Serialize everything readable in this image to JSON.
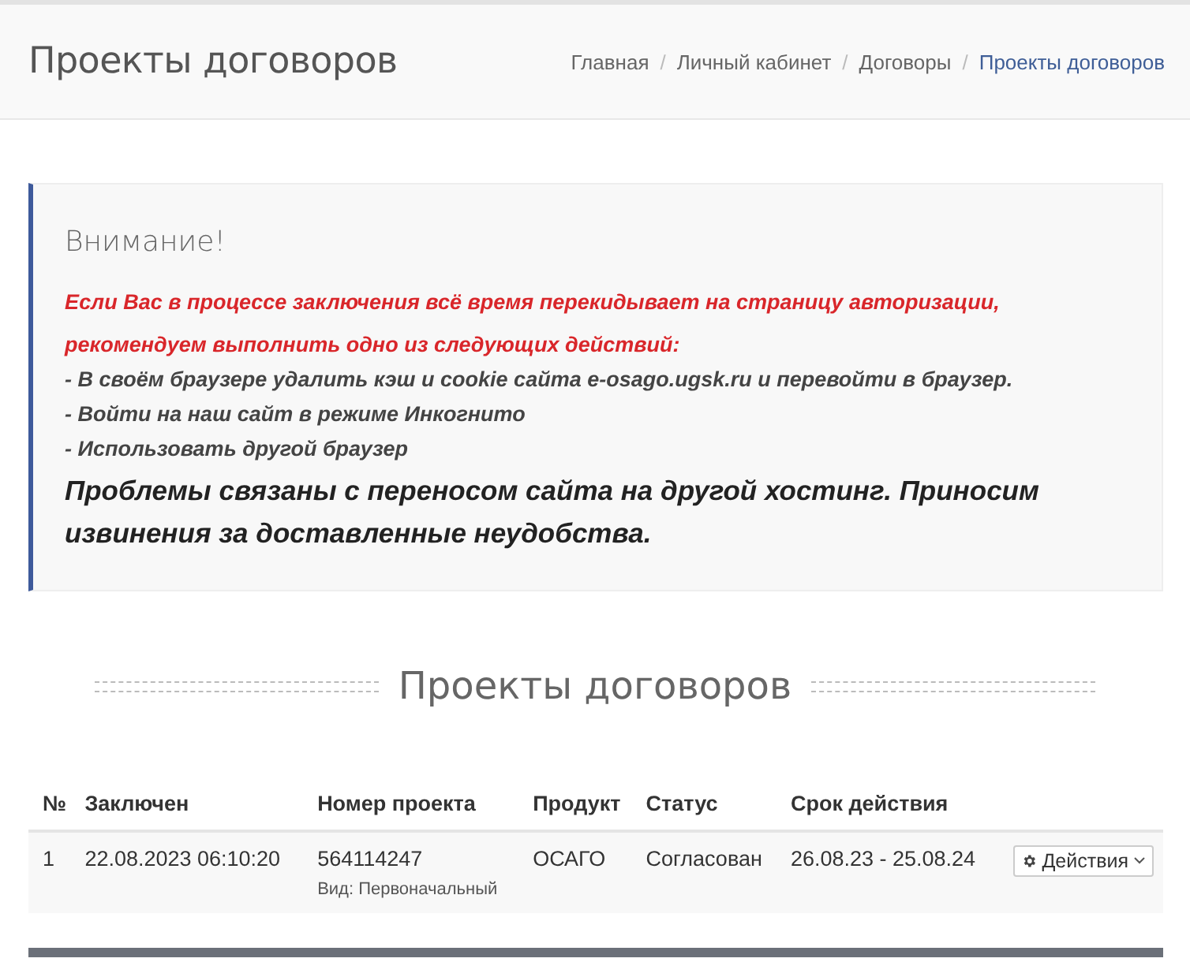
{
  "header": {
    "title": "Проекты договоров",
    "separator": "/",
    "breadcrumbs": [
      {
        "label": "Главная",
        "selected": false
      },
      {
        "label": "Личный кабинет",
        "selected": false
      },
      {
        "label": "Договоры",
        "selected": false
      },
      {
        "label": "Проекты договоров",
        "selected": true
      }
    ]
  },
  "alert": {
    "title": "Внимание!",
    "lines": [
      {
        "kind": "warning",
        "text": "Если Вас в процессе заключения всё время перекидывает на страницу авторизации, рекомендуем выполнить одно из следующих действий:"
      },
      {
        "kind": "step",
        "text": "- В своём браузере удалить кэш и cookie сайта e-osago.ugsk.ru и перевойти в браузер."
      },
      {
        "kind": "step",
        "text": "- Войти на наш сайт в режиме Инкогнито"
      },
      {
        "kind": "step",
        "text": "- Использовать другой браузер"
      },
      {
        "kind": "notice",
        "text": "Проблемы связаны с переносом сайта на другой хостинг. Приносим извинения за доставленные неудобства."
      }
    ]
  },
  "section_title": "Проекты договоров",
  "table": {
    "columns": [
      "№",
      "Заключен",
      "Номер проекта",
      "Продукт",
      "Статус",
      "Срок действия"
    ],
    "rows": [
      {
        "number": "1",
        "concluded": "22.08.2023 06:10:20",
        "project": "564114247",
        "project_type": "Вид: Первоначальный",
        "product": "ОСАГО",
        "status": "Согласован",
        "period": "26.08.23 - 25.08.24",
        "action": "Действия"
      }
    ]
  }
}
